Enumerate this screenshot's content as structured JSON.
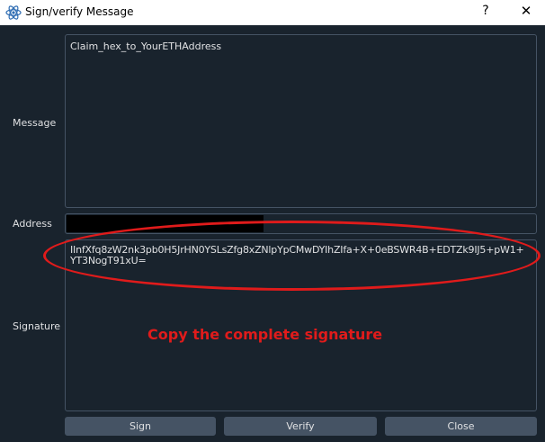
{
  "window": {
    "title": "Sign/verify Message",
    "help_glyph": "?",
    "close_glyph": "✕"
  },
  "form": {
    "message_label": "Message",
    "message_value": "Claim_hex_to_YourETHAddress",
    "address_label": "Address",
    "signature_label": "Signature",
    "signature_value": "IInfXfq8zW2nk3pb0H5JrHN0YSLsZfg8xZNlpYpCMwDYIhZIfa+X+0eBSWR4B+EDTZk9IJ5+pW1+YT3NogT91xU="
  },
  "annotation": {
    "text": "Copy the complete signature",
    "color": "#e01b1b"
  },
  "buttons": {
    "sign": "Sign",
    "verify": "Verify",
    "close": "Close"
  },
  "colors": {
    "background": "#19232d",
    "border": "#455364",
    "text": "#e0e1e3"
  }
}
